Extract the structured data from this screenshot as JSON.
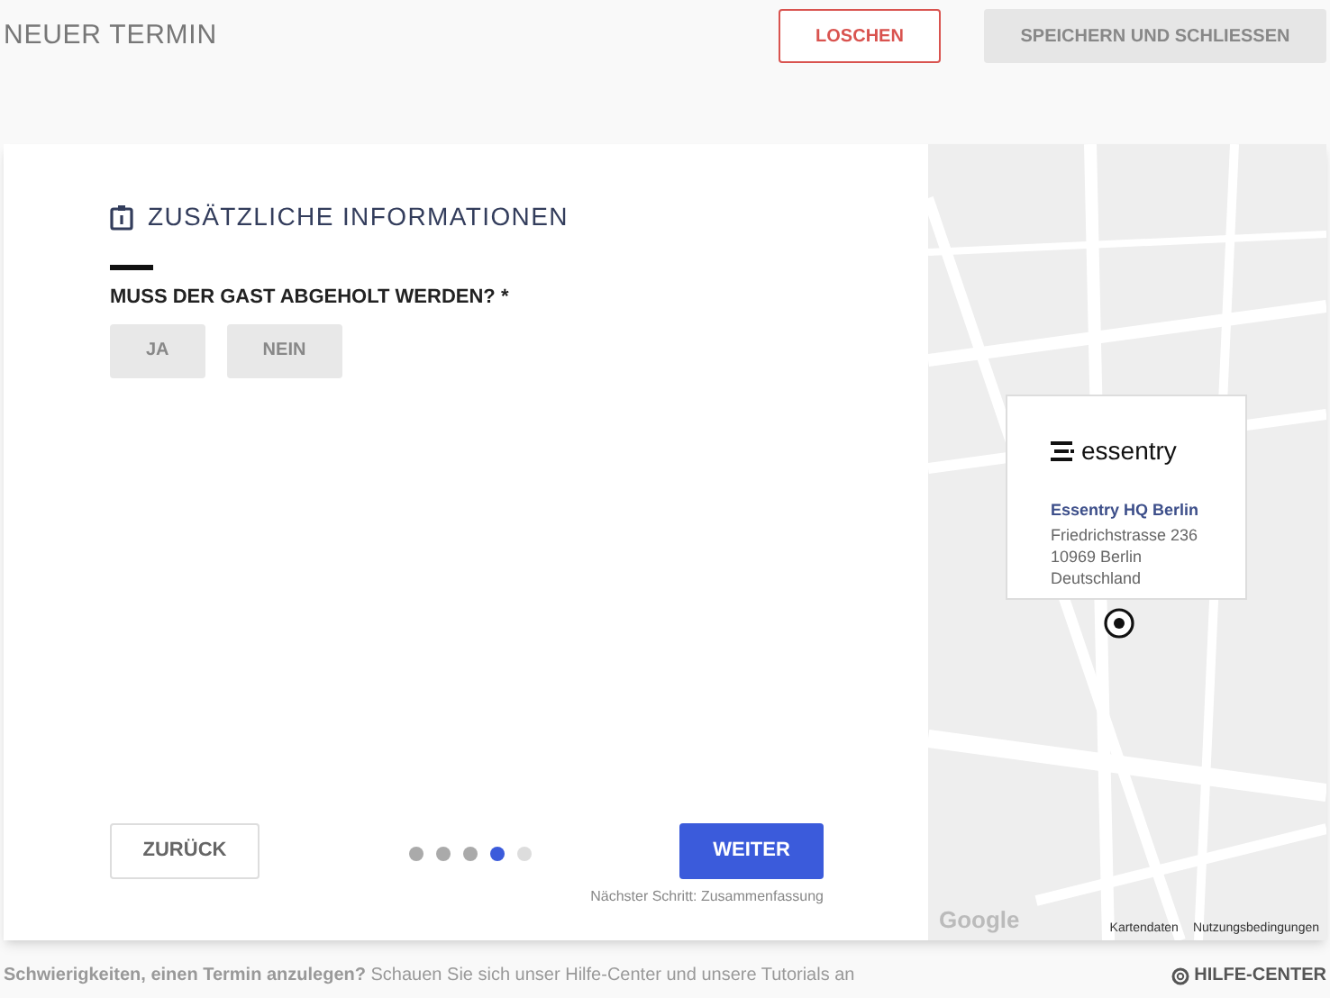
{
  "header": {
    "title": "NEUER TERMIN",
    "buttons": [
      {
        "kind": "danger",
        "label": "LOSCHEN"
      },
      {
        "kind": "secondary",
        "label": "SPEICHERN UND SCHLIESSEN"
      }
    ]
  },
  "form": {
    "section_title": "ZUSÄTZLICHE INFORMATIONEN",
    "question": "MUSS DER GAST ABGEHOLT WERDEN? *",
    "options": [
      {
        "label": "JA",
        "selected": false
      },
      {
        "label": "NEIN",
        "selected": false
      }
    ],
    "back_button": "ZURÜCK",
    "next_button": "WEITER",
    "next_step": "Nächster Schritt: Zusammenfassung",
    "steps": [
      {
        "done": true,
        "selected": false
      },
      {
        "done": true,
        "selected": false
      },
      {
        "done": true,
        "selected": false
      },
      {
        "done": false,
        "selected": true
      },
      {
        "done": false,
        "selected": false
      }
    ]
  },
  "map": {
    "logo": "essentry",
    "location_name": "Essentry HQ Berlin",
    "address_lines": [
      "Friedrichstrasse 236",
      "10969 Berlin",
      "Deutschland"
    ],
    "provider": "Google",
    "attribution": [
      "Kartendaten",
      "Nutzungsbedingungen"
    ]
  },
  "footer": {
    "message": "**Schwierigkeiten, einen Termin anzulegen?** Schauen Sie sich unser Hilfe-Center und unsere Tutorials an",
    "help_link": "HILFE-CENTER"
  }
}
